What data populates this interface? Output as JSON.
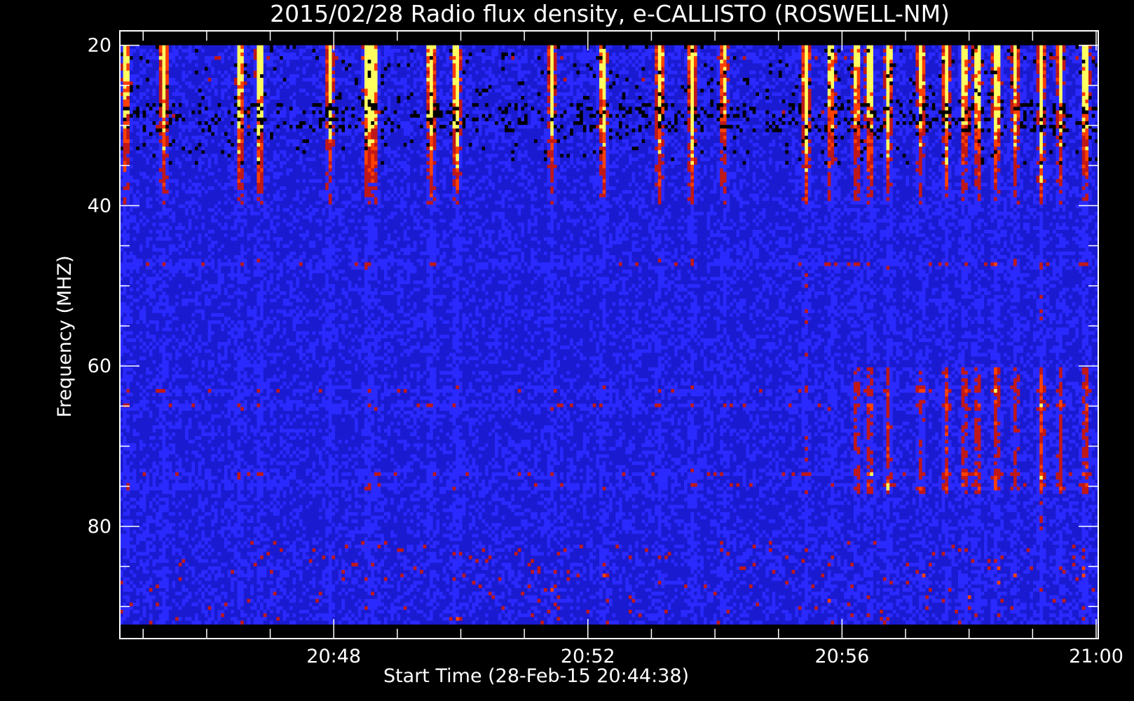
{
  "chart_data": {
    "type": "heatmap",
    "title": "2015/02/28  Radio flux density, e-CALLISTO (ROSWELL-NM)",
    "xlabel": "Start Time (28-Feb-15 20:44:38)",
    "ylabel": "Frequency (MHZ)",
    "x_unit": "minutes since 20:44:38 UTC",
    "x_range": [
      0,
      15.4
    ],
    "x_data_range": [
      0,
      15.4
    ],
    "x_ticks": [
      {
        "label": "20:48",
        "value": 3.3667
      },
      {
        "label": "20:52",
        "value": 7.3667
      },
      {
        "label": "20:56",
        "value": 11.3667
      },
      {
        "label": "21:00",
        "value": 15.3667
      }
    ],
    "x_minor_step": 1,
    "y_range": [
      18.2,
      94.0
    ],
    "y_data_range": [
      20,
      92.2
    ],
    "y_inverted": true,
    "y_ticks": [
      20,
      40,
      60,
      80
    ],
    "y_minor_step": 5,
    "colormap": [
      "#000000",
      "#1a1ad0",
      "#2a2aff",
      "#c01818",
      "#ff4000",
      "#ffff60"
    ],
    "features": {
      "strong_bursts_min": [
        0.1,
        0.7,
        1.9,
        2.2,
        3.3,
        3.9,
        4.0,
        4.9,
        5.3,
        6.8,
        7.6,
        8.5,
        9.0,
        9.5,
        10.8,
        11.2,
        11.6,
        11.8,
        12.1,
        12.6,
        13.0,
        13.3,
        13.5,
        13.8,
        14.1,
        14.5,
        14.8,
        15.2
      ],
      "interference_bands_mhz": [
        21.5,
        24.5,
        28.5,
        30.0,
        47.3,
        63.0,
        65.0,
        73.5,
        75.0
      ],
      "late_activity_from_min": 11.4
    }
  }
}
